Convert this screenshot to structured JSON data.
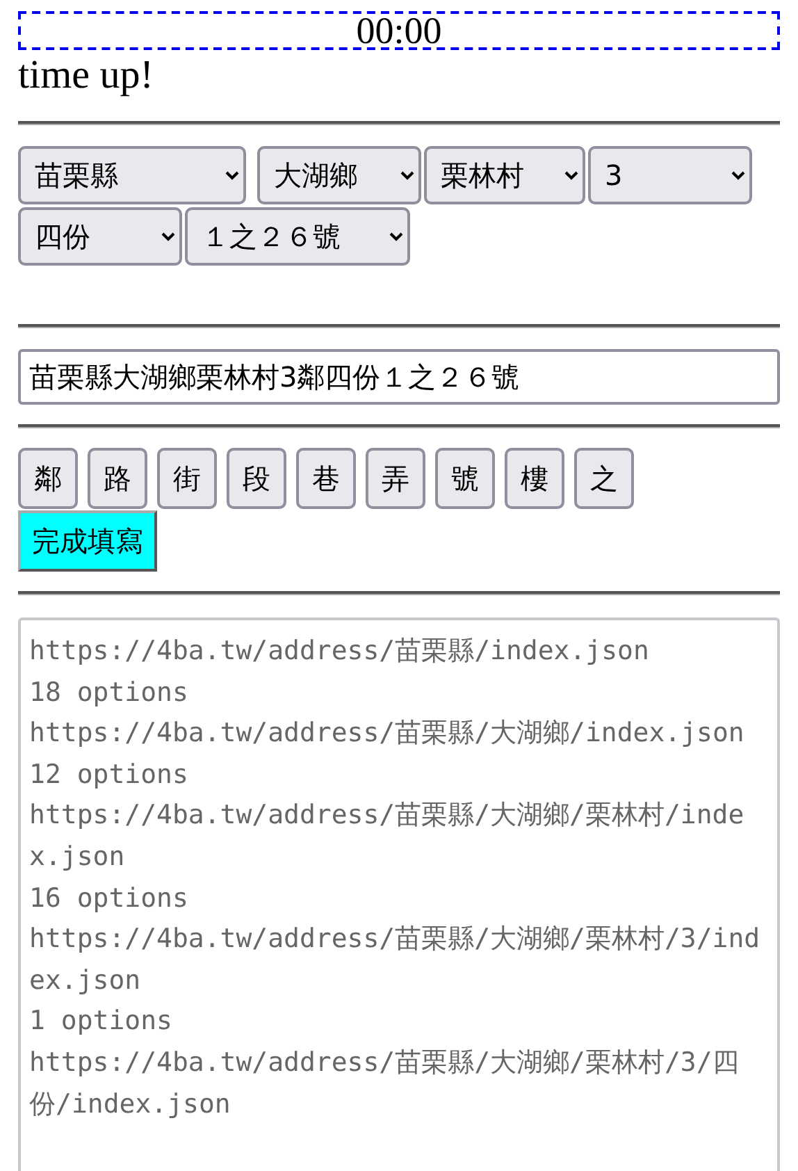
{
  "timer": "00:00",
  "message": "time up!",
  "selects": [
    "苗栗縣",
    "大湖鄉",
    "栗林村",
    "3",
    "四份",
    "１之２６號"
  ],
  "address_field": {
    "value": "苗栗縣大湖鄉栗林村3鄰四份１之２６號"
  },
  "char_buttons": [
    "鄰",
    "路",
    "街",
    "段",
    "巷",
    "弄",
    "號",
    "樓",
    "之"
  ],
  "submit_button": "完成填寫",
  "log": [
    "https://4ba.tw/address/苗栗縣/index.json",
    "18 options",
    "https://4ba.tw/address/苗栗縣/大湖鄉/index.json",
    "12 options",
    "https://4ba.tw/address/苗栗縣/大湖鄉/栗林村/index.json",
    "16 options",
    "https://4ba.tw/address/苗栗縣/大湖鄉/栗林村/3/index.json",
    "1 options",
    "https://4ba.tw/address/苗栗縣/大湖鄉/栗林村/3/四份/index.json"
  ]
}
